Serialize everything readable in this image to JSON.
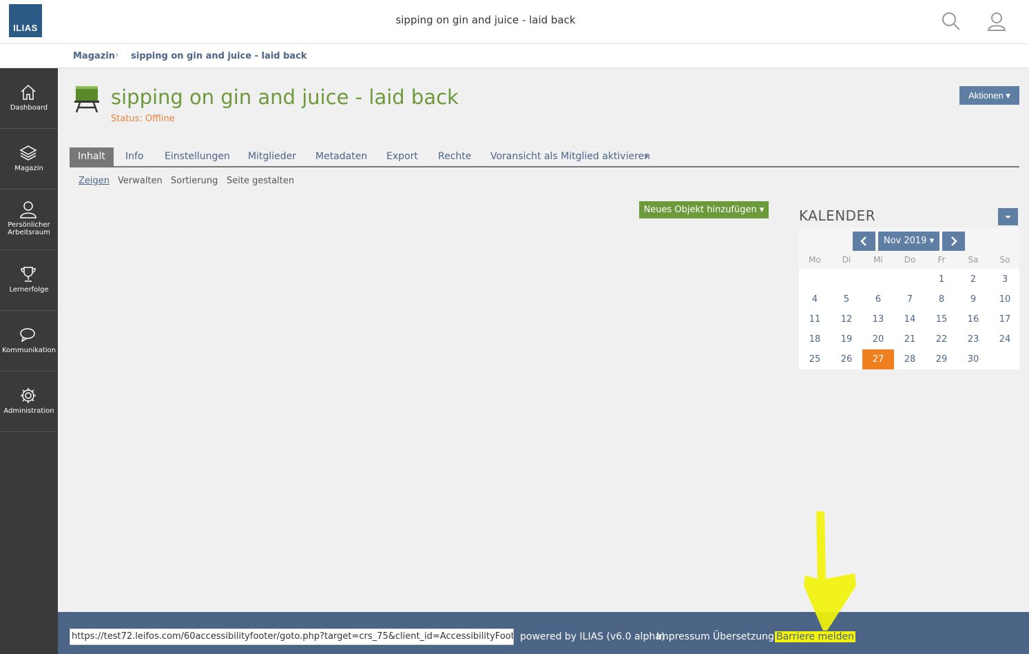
{
  "header": {
    "logo_text": "ILIAS",
    "title": "sipping on gin and juice - laid back"
  },
  "breadcrumb": {
    "items": [
      "Magazin",
      "sipping on gin and juice - laid back"
    ]
  },
  "sidebar": {
    "items": [
      {
        "label": "Dashboard",
        "icon": "home-icon"
      },
      {
        "label": "Magazin",
        "icon": "layers-icon"
      },
      {
        "label": "Persönlicher Arbeitsraum",
        "icon": "user-icon"
      },
      {
        "label": "Lernerfolge",
        "icon": "trophy-icon"
      },
      {
        "label": "Kommunikation",
        "icon": "chat-icon"
      },
      {
        "label": "Administration",
        "icon": "gear-icon"
      }
    ]
  },
  "object": {
    "title": "sipping on gin and juice - laid back",
    "status": "Status: Offline",
    "actions_label": "Aktionen"
  },
  "tabs": [
    "Inhalt",
    "Info",
    "Einstellungen",
    "Mitglieder",
    "Metadaten",
    "Export",
    "Rechte",
    "Voransicht als Mitglied aktivieren"
  ],
  "subtabs": [
    "Zeigen",
    "Verwalten",
    "Sortierung",
    "Seite gestalten"
  ],
  "add_object_label": "Neues Objekt hinzufügen",
  "calendar": {
    "title": "KALENDER",
    "month_label": "Nov 2019",
    "weekdays": [
      "Mo",
      "Di",
      "Mi",
      "Do",
      "Fr",
      "Sa",
      "So"
    ],
    "today": "27",
    "weeks": [
      [
        "",
        "",
        "",
        "",
        "1",
        "2",
        "3"
      ],
      [
        "4",
        "5",
        "6",
        "7",
        "8",
        "9",
        "10"
      ],
      [
        "11",
        "12",
        "13",
        "14",
        "15",
        "16",
        "17"
      ],
      [
        "18",
        "19",
        "20",
        "21",
        "22",
        "23",
        "24"
      ],
      [
        "25",
        "26",
        "27",
        "28",
        "29",
        "30",
        ""
      ]
    ]
  },
  "footer": {
    "url": "https://test72.leifos.com/60accessibilityfooter/goto.php?target=crs_75&client_id=AccessibilityFooter",
    "powered_by": "powered by ILIAS (v6.0 alpha)",
    "impressum": "Impressum",
    "uebersetzung": "Übersetzung",
    "barriere": "Barriere melden"
  },
  "colors": {
    "accent": "#5f7ea3",
    "title_green": "#6c9a3b",
    "status_orange": "#e8813a",
    "today_orange": "#f07f20",
    "footer_bg": "#4c6586",
    "highlight_yellow": "#f2f20a"
  }
}
